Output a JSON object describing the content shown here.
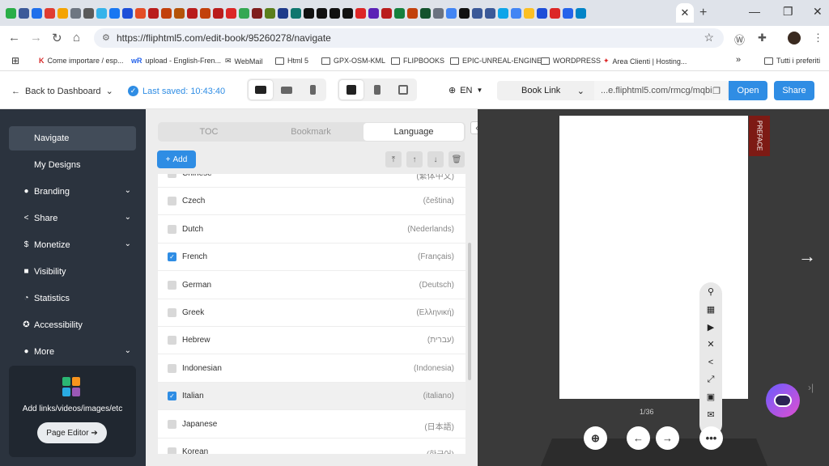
{
  "browser": {
    "tab_close": "✕",
    "new_tab": "+",
    "minimize": "—",
    "restore": "❐",
    "close": "✕",
    "url": "https://fliphtml5.com/edit-book/95260278/navigate",
    "favicons": [
      "#2aae47",
      "#3c5a99",
      "#1f6feb",
      "#e03c31",
      "#f4a300",
      "#6e7681",
      "#5a5a5a",
      "#35b3ea",
      "#1877f2",
      "#1d4ed8",
      "#e44d26",
      "#b91c1c",
      "#c2410c",
      "#b45309",
      "#b91c1c",
      "#c2410c",
      "#b91c1c",
      "#dc2626",
      "#34a853",
      "#7f1d1d",
      "#5b7f1b",
      "#1e3a8a",
      "#0f766e",
      "#111111",
      "#111111",
      "#111111",
      "#111111",
      "#dc2626",
      "#5b21b6",
      "#b91c1c",
      "#15803d",
      "#c2410c",
      "#14532d",
      "#6b7280",
      "#4285f4",
      "#111111",
      "#3b5998",
      "#3b5998",
      "#0ea5e9",
      "#4285f4",
      "#fbbf24",
      "#1d4ed8",
      "#dc2626",
      "#2563eb",
      "#0284c7"
    ]
  },
  "bookmarks": [
    {
      "label": "Come importare / esp..."
    },
    {
      "label": "upload - English-Fren..."
    },
    {
      "label": "WebMail"
    },
    {
      "label": "Html 5"
    },
    {
      "label": "GPX-OSM-KML"
    },
    {
      "label": "FLIPBOOKS"
    },
    {
      "label": "EPIC-UNREAL-ENGINE"
    },
    {
      "label": "WORDPRESS"
    },
    {
      "label": "Area Clienti | Hosting..."
    },
    {
      "label": "Tutti i preferiti"
    }
  ],
  "bookmarks_more": "»",
  "header": {
    "back_label": "Back to Dashboard",
    "saved_label": "Last saved: 10:43:40",
    "lang": "EN",
    "booklink_label": "Book Link",
    "booklink_url": "...e.fliphtml5.com/rmcg/mqbi",
    "open_label": "Open",
    "share_label": "Share"
  },
  "sidebar": {
    "items": [
      {
        "label": "Navigate"
      },
      {
        "label": "My Designs"
      },
      {
        "label": "Branding"
      },
      {
        "label": "Share"
      },
      {
        "label": "Monetize"
      },
      {
        "label": "Visibility"
      },
      {
        "label": "Statistics"
      },
      {
        "label": "Accessibility"
      },
      {
        "label": "More"
      }
    ],
    "promo_text": "Add links/videos/images/etc",
    "page_editor": "Page Editor ➔"
  },
  "panel": {
    "tabs": [
      "TOC",
      "Bookmark",
      "Language"
    ],
    "add_label": "Add",
    "languages": [
      {
        "name": "Chinese",
        "native": "(繁体中文)",
        "checked": false
      },
      {
        "name": "Czech",
        "native": "(čeština)",
        "checked": false
      },
      {
        "name": "Dutch",
        "native": "(Nederlands)",
        "checked": false
      },
      {
        "name": "French",
        "native": "(Français)",
        "checked": true
      },
      {
        "name": "German",
        "native": "(Deutsch)",
        "checked": false
      },
      {
        "name": "Greek",
        "native": "(Ελληνική)",
        "checked": false
      },
      {
        "name": "Hebrew",
        "native": "(עברית)",
        "checked": false
      },
      {
        "name": "Indonesian",
        "native": "(Indonesia)",
        "checked": false
      },
      {
        "name": "Italian",
        "native": "(italiano)",
        "checked": true
      },
      {
        "name": "Japanese",
        "native": "(日本語)",
        "checked": false
      },
      {
        "name": "Korean",
        "native": "(한국어)",
        "checked": false
      }
    ]
  },
  "preview": {
    "preface_label": "PREFACE",
    "page_counter": "1/36"
  }
}
